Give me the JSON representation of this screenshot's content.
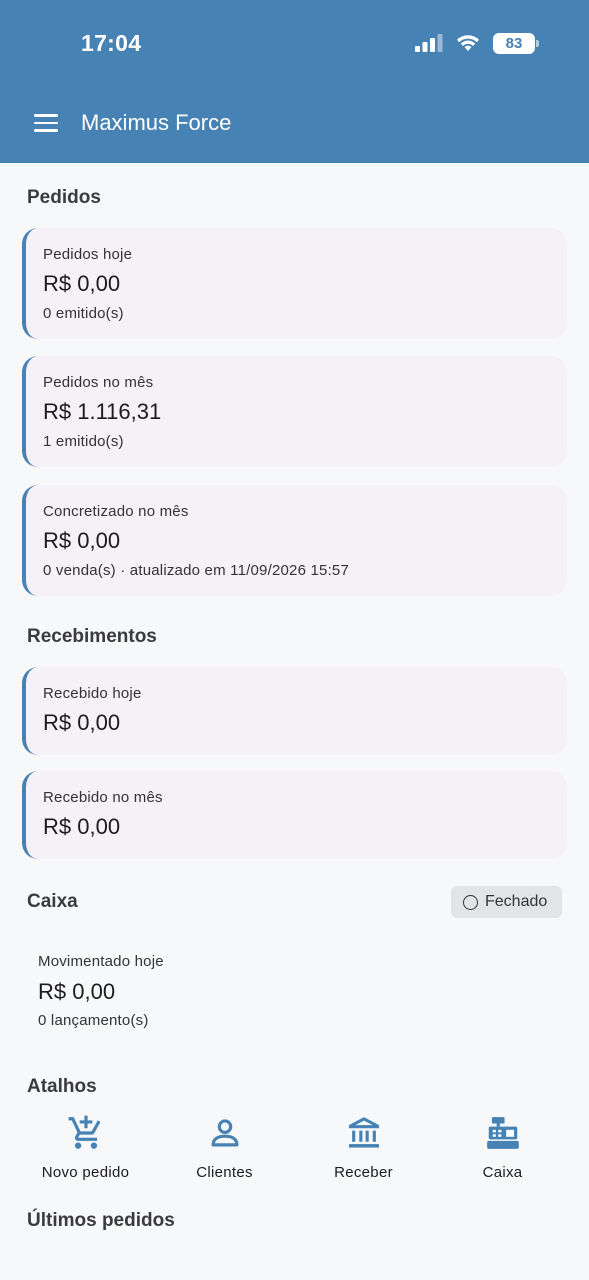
{
  "status_bar": {
    "time": "17:04",
    "battery": "83"
  },
  "app_bar": {
    "title": "Maximus Force"
  },
  "pedidos": {
    "title": "Pedidos",
    "cards": [
      {
        "label": "Pedidos hoje",
        "value": "R$ 0,00",
        "sub": "0 emitido(s)"
      },
      {
        "label": "Pedidos no mês",
        "value": "R$ 1.116,31",
        "sub": "1 emitido(s)"
      },
      {
        "label": "Concretizado no mês",
        "value": "R$ 0,00",
        "sub": "0 venda(s) · atualizado em 11/09/2026 15:57"
      }
    ]
  },
  "recebimentos": {
    "title": "Recebimentos",
    "cards": [
      {
        "label": "Recebido hoje",
        "value": "R$ 0,00"
      },
      {
        "label": "Recebido no mês",
        "value": "R$ 0,00"
      }
    ]
  },
  "caixa": {
    "title": "Caixa",
    "status": "Fechado",
    "label": "Movimentado hoje",
    "value": "R$ 0,00",
    "sub": "0 lançamento(s)"
  },
  "atalhos": {
    "title": "Atalhos",
    "items": [
      {
        "label": "Novo pedido",
        "icon": "add-shopping-cart-icon"
      },
      {
        "label": "Clientes",
        "icon": "person-icon"
      },
      {
        "label": "Receber",
        "icon": "bank-icon"
      },
      {
        "label": "Caixa",
        "icon": "cash-register-icon"
      }
    ]
  },
  "ultimos_pedidos": {
    "title": "Últimos pedidos"
  },
  "colors": {
    "primary": "#4682b4",
    "card_bg": "#f5f1f6",
    "page_bg": "#f7f8fa"
  }
}
